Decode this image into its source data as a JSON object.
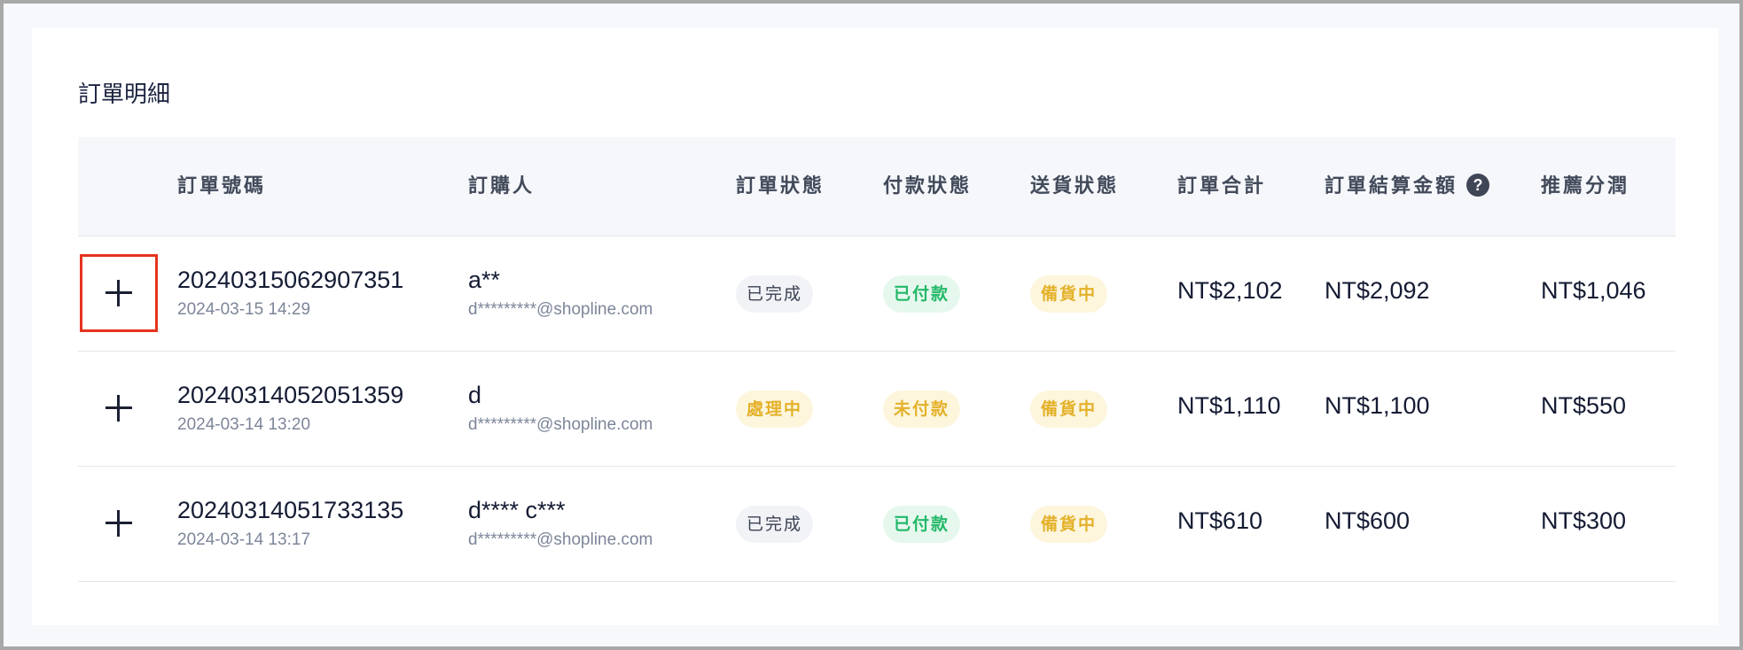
{
  "page": {
    "title": "訂單明細"
  },
  "table": {
    "headers": {
      "order_no": "訂單號碼",
      "buyer": "訂購人",
      "order_status": "訂單狀態",
      "payment_status": "付款狀態",
      "delivery_status": "送貨狀態",
      "order_total": "訂單合計",
      "settlement": "訂單結算金額",
      "commission": "推薦分潤"
    },
    "help_icon_glyph": "?",
    "rows": [
      {
        "order_no": "20240315062907351",
        "date": "2024-03-15 14:29",
        "buyer_name": "a**",
        "buyer_email": "d*********@shopline.com",
        "order_status": "已完成",
        "order_status_color": "gray",
        "payment_status": "已付款",
        "payment_status_color": "green",
        "delivery_status": "備貨中",
        "delivery_status_color": "yellow",
        "order_total": "NT$2,102",
        "settlement": "NT$2,092",
        "commission": "NT$1,046"
      },
      {
        "order_no": "20240314052051359",
        "date": "2024-03-14 13:20",
        "buyer_name": "d",
        "buyer_email": "d*********@shopline.com",
        "order_status": "處理中",
        "order_status_color": "yellow",
        "payment_status": "未付款",
        "payment_status_color": "yellow",
        "delivery_status": "備貨中",
        "delivery_status_color": "yellow",
        "order_total": "NT$1,110",
        "settlement": "NT$1,100",
        "commission": "NT$550"
      },
      {
        "order_no": "20240314051733135",
        "date": "2024-03-14 13:17",
        "buyer_name": "d**** c***",
        "buyer_email": "d*********@shopline.com",
        "order_status": "已完成",
        "order_status_color": "gray",
        "payment_status": "已付款",
        "payment_status_color": "green",
        "delivery_status": "備貨中",
        "delivery_status_color": "yellow",
        "order_total": "NT$610",
        "settlement": "NT$600",
        "commission": "NT$300"
      }
    ]
  },
  "colors": {
    "focus_outline": "#e5341e",
    "badge_green_text": "#23b868",
    "badge_yellow_text": "#e4b12a",
    "badge_gray_text": "#3b4254"
  }
}
